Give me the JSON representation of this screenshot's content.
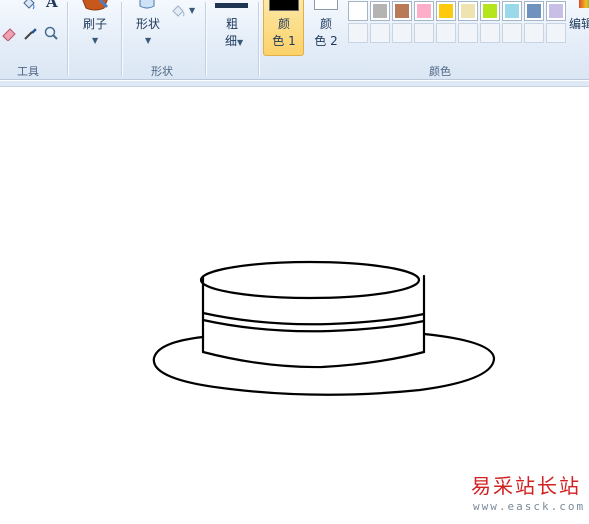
{
  "ribbon": {
    "tools_group_label": "工具",
    "brushes_label": "刷子",
    "shapes_label": "形状",
    "shapes_group_label": "形状",
    "size_label_top": "粗",
    "size_label_bottom": "细",
    "color1_label_top": "颜",
    "color1_label_bottom": "色 1",
    "color2_label_top": "颜",
    "color2_label_bottom": "色 2",
    "colors_group_label": "颜色",
    "edit_colors_label": "编辑",
    "text_tool_glyph": "A"
  },
  "palette": {
    "row1": [
      "#ffffff",
      "#b4b4b4",
      "#b97a57",
      "#ffaec9",
      "#ffc90e",
      "#efe4b0",
      "#b5e61d",
      "#99d9ea",
      "#7092be",
      "#c8bfe7"
    ],
    "active_color1": "#000000",
    "active_color2": "#ffffff"
  },
  "watermark": {
    "text": "易采站长站",
    "url": "www.easck.com"
  }
}
